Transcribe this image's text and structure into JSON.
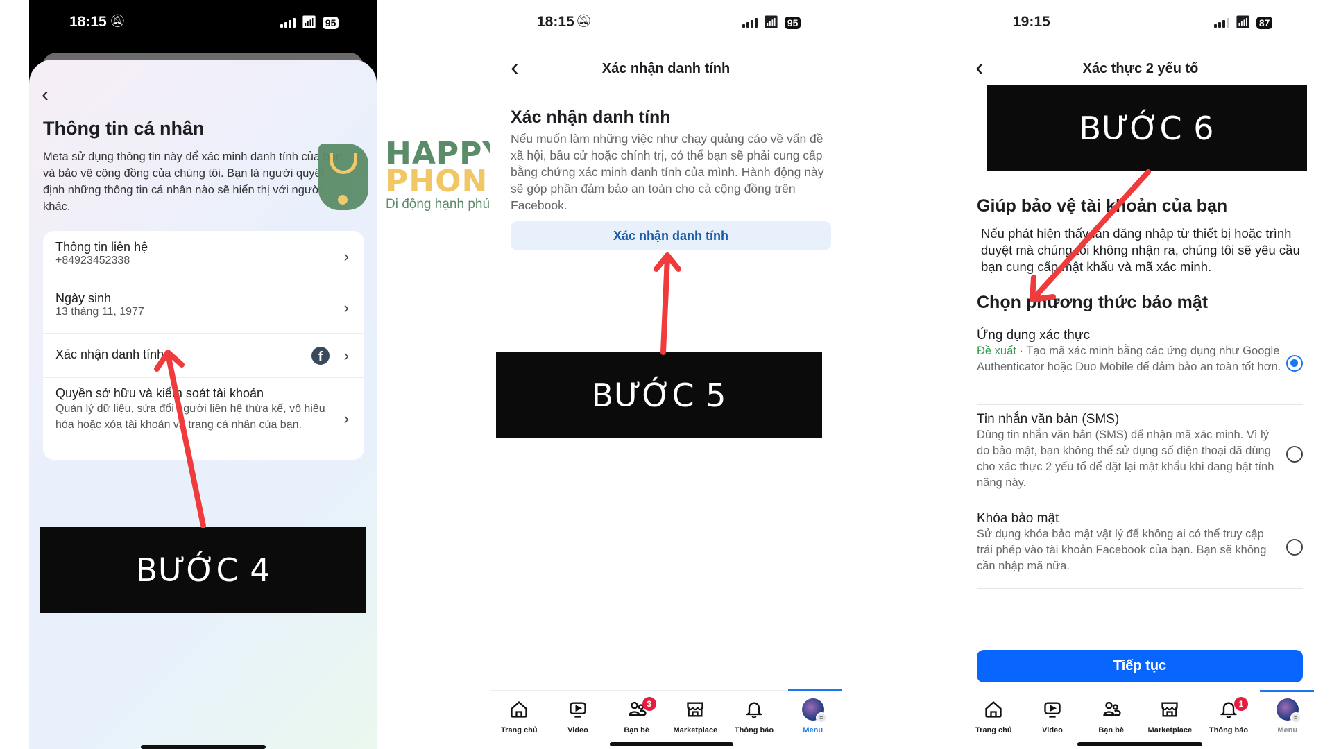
{
  "panel1": {
    "status": {
      "time": "18:15",
      "battery": "95"
    },
    "title": "Thông tin cá nhân",
    "description": "Meta sử dụng thông tin này để xác minh danh tính của bạn và bảo vệ cộng đồng của chúng tôi. Bạn là người quyết định những thông tin cá nhân nào sẽ hiển thị với người khác.",
    "items": [
      {
        "label": "Thông tin liên hệ",
        "sub": "+84923452338"
      },
      {
        "label": "Ngày sinh",
        "sub": "13 tháng 11, 1977"
      },
      {
        "label": "Xác nhận danh tính",
        "sub": ""
      },
      {
        "label": "Quyền sở hữu và kiểm soát tài khoản",
        "sub": "Quản lý dữ liệu, sửa đổi người liên hệ thừa kế, vô hiệu hóa hoặc xóa tài khoản và trang cá nhân của bạn."
      }
    ],
    "step_label": "BƯỚC 4"
  },
  "logo": {
    "line1": "HAPPY",
    "line2": "PHONE",
    "tagline": "Di động hạnh phúc"
  },
  "panel2": {
    "status": {
      "time": "18:15",
      "battery": "95"
    },
    "nav_title": "Xác nhận danh tính",
    "heading": "Xác nhận danh tính",
    "description": "Nếu muốn làm những việc như chạy quảng cáo về vấn đề xã hội, bầu cử hoặc chính trị, có thể bạn sẽ phải cung cấp bằng chứng xác minh danh tính của mình. Hành động này sẽ góp phần đảm bảo an toàn cho cả cộng đồng trên Facebook.",
    "button": "Xác nhận danh tính",
    "step_label": "BƯỚC 5",
    "tabs": [
      {
        "label": "Trang chủ",
        "icon": "home-icon",
        "badge": ""
      },
      {
        "label": "Video",
        "icon": "video-icon",
        "badge": ""
      },
      {
        "label": "Bạn bè",
        "icon": "friends-icon",
        "badge": "3"
      },
      {
        "label": "Marketplace",
        "icon": "marketplace-icon",
        "badge": ""
      },
      {
        "label": "Thông báo",
        "icon": "bell-icon",
        "badge": ""
      },
      {
        "label": "Menu",
        "icon": "avatar-icon",
        "badge": "",
        "active": true
      }
    ]
  },
  "panel3": {
    "status": {
      "time": "19:15",
      "battery": "87"
    },
    "nav_title": "Xác thực 2 yếu tố",
    "step_label": "BƯỚC 6",
    "heading": "Giúp bảo vệ tài khoản của bạn",
    "description": "Nếu phát hiện thấy lần đăng nhập từ thiết bị hoặc trình duyệt mà chúng tôi không nhận ra, chúng tôi sẽ yêu cầu bạn cung cấp mật khẩu và mã xác minh.",
    "subheading": "Chọn phương thức bảo mật",
    "options": [
      {
        "title": "Ứng dụng xác thực",
        "recommended": "Đề xuất",
        "description": " · Tạo mã xác minh bằng các ứng dụng như Google Authenticator hoặc Duo Mobile để đảm bảo an toàn tốt hơn.",
        "selected": true
      },
      {
        "title": "Tin nhắn văn bản (SMS)",
        "recommended": "",
        "description": "Dùng tin nhắn văn bản (SMS) để nhận mã xác minh. Vì lý do bảo mật, bạn không thể sử dụng số điện thoại đã dùng cho xác thực 2 yếu tố để đặt lại mật khẩu khi đang bật tính năng này.",
        "selected": false
      },
      {
        "title": "Khóa bảo mật",
        "recommended": "",
        "description": "Sử dụng khóa bảo mật vật lý để không ai có thể truy cập trái phép vào tài khoản Facebook của bạn. Bạn sẽ không cần nhập mã nữa.",
        "selected": false
      }
    ],
    "continue_button": "Tiếp tục",
    "tabs": [
      {
        "label": "Trang chủ",
        "icon": "home-icon",
        "badge": ""
      },
      {
        "label": "Video",
        "icon": "video-icon",
        "badge": ""
      },
      {
        "label": "Bạn bè",
        "icon": "friends-icon",
        "badge": ""
      },
      {
        "label": "Marketplace",
        "icon": "marketplace-icon",
        "badge": ""
      },
      {
        "label": "Thông báo",
        "icon": "bell-icon",
        "badge": "1"
      },
      {
        "label": "Menu",
        "icon": "avatar-icon",
        "badge": "",
        "active": true
      }
    ]
  },
  "colors": {
    "accent": "#1877f2",
    "primary_button": "#0866ff",
    "arrow": "#ef3b3b",
    "step_box": "#0b0b0b",
    "logo_green": "#5b8c69",
    "logo_yellow": "#f1c766"
  }
}
